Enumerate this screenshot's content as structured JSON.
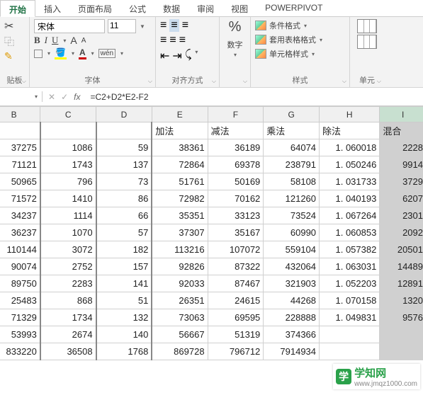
{
  "tabs": {
    "t0": "开始",
    "t1": "插入",
    "t2": "页面布局",
    "t3": "公式",
    "t4": "数据",
    "t5": "审阅",
    "t6": "视图",
    "t7": "POWERPIVOT"
  },
  "ribbon": {
    "clipboard_label": "贴板",
    "font": {
      "name": "宋体",
      "size": "11",
      "label": "字体",
      "b": "B",
      "i": "I",
      "u": "U",
      "a_big": "A",
      "a_small": "A",
      "wen": "wén",
      "a_color": "A"
    },
    "align_label": "对齐方式",
    "number": {
      "pct": "%",
      "label": "数字"
    },
    "styles": {
      "cond": "条件格式",
      "table": "套用表格格式",
      "cell": "单元格样式",
      "label": "样式"
    },
    "cells": {
      "label": "单元"
    }
  },
  "formula": {
    "fx": "fx",
    "x": "✕",
    "check": "✓",
    "value": "=C2+D2*E2-F2"
  },
  "cols": {
    "B": "B",
    "C": "C",
    "D": "D",
    "E": "E",
    "F": "F",
    "G": "G",
    "H": "H",
    "I": "I"
  },
  "headers": {
    "E": "加法",
    "F": "减法",
    "G": "乘法",
    "H": "除法",
    "I": "混合"
  },
  "chart_data": {
    "type": "table",
    "columns": [
      "B",
      "C",
      "D",
      "加法",
      "减法",
      "乘法",
      "除法",
      "混合"
    ],
    "rows": [
      [
        37275,
        1086,
        59,
        38361,
        36189,
        64074,
        1.060018,
        2228
      ],
      [
        71121,
        1743,
        137,
        72864,
        69378,
        238791,
        1.050246,
        9914
      ],
      [
        50965,
        796,
        73,
        51761,
        50169,
        58108,
        1.031733,
        3729
      ],
      [
        71572,
        1410,
        86,
        72982,
        70162,
        121260,
        1.040193,
        6207
      ],
      [
        34237,
        1114,
        66,
        35351,
        33123,
        73524,
        1.067264,
        2301
      ],
      [
        36237,
        1070,
        57,
        37307,
        35167,
        60990,
        1.060853,
        2092
      ],
      [
        110144,
        3072,
        182,
        113216,
        107072,
        559104,
        1.057382,
        20501
      ],
      [
        90074,
        2752,
        157,
        92826,
        87322,
        432064,
        1.063031,
        14489
      ],
      [
        89750,
        2283,
        141,
        92033,
        87467,
        321903,
        1.052203,
        12891
      ],
      [
        25483,
        868,
        51,
        26351,
        24615,
        44268,
        1.070158,
        1320
      ],
      [
        71329,
        1734,
        132,
        73063,
        69595,
        228888,
        1.049831,
        9576
      ],
      [
        53993,
        2674,
        140,
        56667,
        51319,
        374366,
        null,
        null
      ],
      [
        833220,
        36508,
        1768,
        869728,
        796712,
        7914934,
        null,
        null
      ]
    ]
  },
  "watermark": {
    "logo": "学",
    "name": "学知网",
    "url": "www.jmqz1000.com"
  }
}
